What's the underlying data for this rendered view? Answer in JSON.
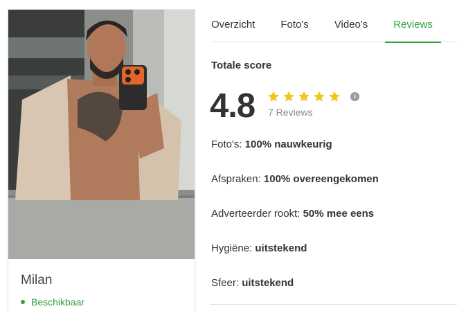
{
  "profile": {
    "name": "Milan",
    "status": "Beschikbaar",
    "photo_description": ""
  },
  "tabs": [
    {
      "label": "Overzicht",
      "active": false
    },
    {
      "label": "Foto's",
      "active": false
    },
    {
      "label": "Video's",
      "active": false
    },
    {
      "label": "Reviews",
      "active": true
    }
  ],
  "reviews": {
    "title": "Totale score",
    "score": "4.8",
    "stars": 5,
    "count_label": "7 Reviews",
    "info_icon": "i"
  },
  "attributes": [
    {
      "label": "Foto's:",
      "value": "100% nauwkeurig"
    },
    {
      "label": "Afspraken:",
      "value": "100% overeengekomen"
    },
    {
      "label": "Adverteerder rookt:",
      "value": "50% mee eens"
    },
    {
      "label": "Hygiëne:",
      "value": "uitstekend"
    },
    {
      "label": "Sfeer:",
      "value": "uitstekend"
    }
  ],
  "colors": {
    "accent": "#2e9e3f",
    "star": "#f5c518",
    "text": "#333333",
    "muted": "#888888"
  }
}
